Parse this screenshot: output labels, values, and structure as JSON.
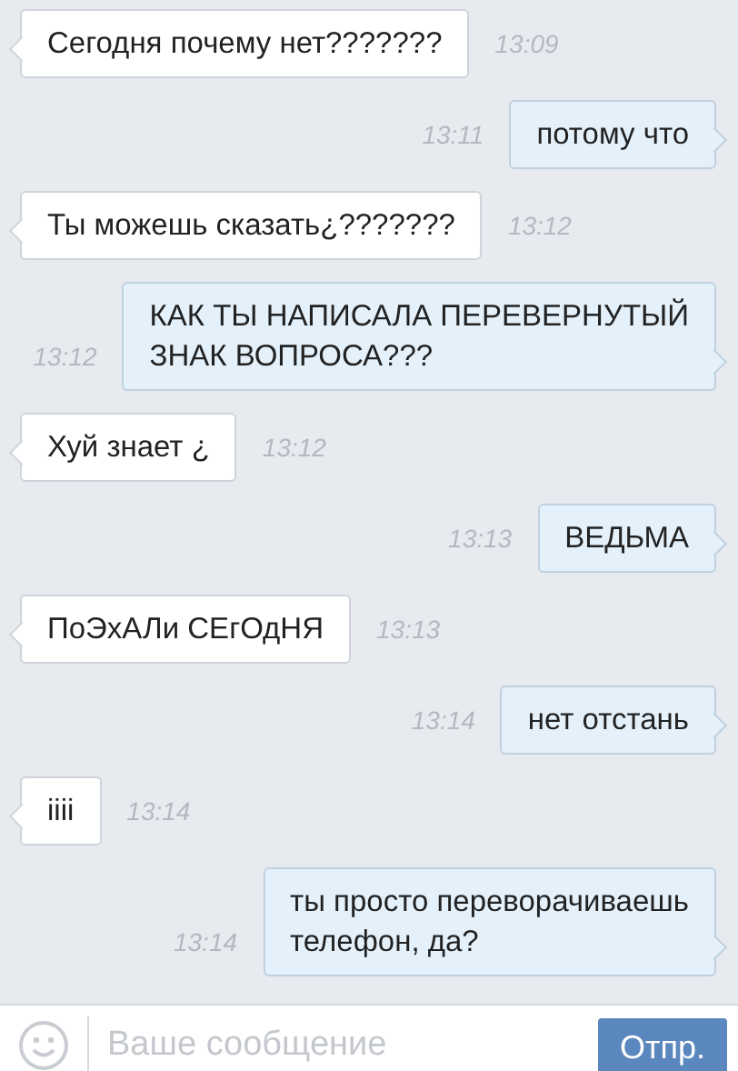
{
  "messages": [
    {
      "kind": "in",
      "lines": [
        "Сегодня почему нет???????"
      ],
      "time": "13:09"
    },
    {
      "kind": "out",
      "lines": [
        "потому что"
      ],
      "time": "13:11"
    },
    {
      "kind": "in",
      "lines": [
        "Ты можешь сказать¿???????"
      ],
      "time": "13:12"
    },
    {
      "kind": "out",
      "lines": [
        "КАК ТЫ НАПИСАЛА ПЕРЕВЕРНУТЫЙ",
        "ЗНАК ВОПРОСА???"
      ],
      "time": "13:12"
    },
    {
      "kind": "in",
      "lines": [
        "Хуй знает ¿"
      ],
      "time": "13:12"
    },
    {
      "kind": "out",
      "lines": [
        "ВЕДЬМА"
      ],
      "time": "13:13"
    },
    {
      "kind": "in",
      "lines": [
        "ПоЭхАЛи СЕгОдНЯ"
      ],
      "time": "13:13"
    },
    {
      "kind": "out",
      "lines": [
        "нет отстань"
      ],
      "time": "13:14"
    },
    {
      "kind": "in",
      "lines": [
        "iiii"
      ],
      "time": "13:14"
    },
    {
      "kind": "out",
      "lines": [
        "ты просто переворачиваешь",
        "телефон, да?"
      ],
      "time": "13:14"
    }
  ],
  "composer": {
    "placeholder": "Ваше сообщение",
    "send_button": "Отпр."
  }
}
